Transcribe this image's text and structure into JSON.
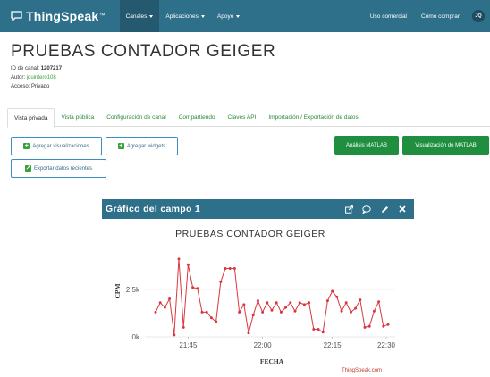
{
  "navbar": {
    "brand": "ThingSpeak",
    "brand_tm": "™",
    "menus": [
      {
        "label": "Canales",
        "active": true
      },
      {
        "label": "Aplicaciones",
        "active": false
      },
      {
        "label": "Apoyo",
        "active": false
      }
    ],
    "right_links": [
      "Uso comercial",
      "Cómo comprar"
    ],
    "avatar": "JQ"
  },
  "channel": {
    "title": "PRUEBAS CONTADOR GEIGER",
    "id_label": "ID de canal:",
    "id_value": "1207217",
    "author_label": "Autor:",
    "author_value": "jquintero108",
    "access_label": "Acceso:",
    "access_value": "Privado"
  },
  "tabs": [
    "Vista privada",
    "Vista pública",
    "Configuración de canal",
    "Compartiendo",
    "Claves API",
    "Importación / Exportación de datos"
  ],
  "buttons": {
    "add_visualizations": "Agregar visualizaciones",
    "add_widgets": "Agregar widgets",
    "export_data": "Exportar datos recientes",
    "matlab_analysis": "Análisis MATLAB",
    "matlab_visualization": "Visualización de MATLAB"
  },
  "widget": {
    "title": "Gráfico del campo 1",
    "icons": [
      "external-link-icon",
      "comment-icon",
      "pencil-icon",
      "close-icon"
    ],
    "credit": "ThingSpeak.com"
  },
  "colors": {
    "navbar": "#2e6f8a",
    "series": "#d9363e",
    "green_button": "#1f8f3f"
  },
  "chart_data": {
    "type": "line",
    "title": "PRUEBAS CONTADOR GEIGER",
    "xlabel": "FECHA",
    "ylabel": "CPM",
    "x_ticks": [
      "21:45",
      "22:00",
      "22:15",
      "22:30"
    ],
    "y_ticks": [
      "0k",
      "2.5k"
    ],
    "ylim": [
      0,
      4800
    ],
    "grid": true,
    "series": [
      {
        "values": [
          1300,
          1800,
          1550,
          2000,
          100,
          4100,
          500,
          3800,
          2600,
          2550,
          1300,
          1300,
          1000,
          800,
          2900,
          3600,
          3600,
          3600,
          1300,
          1700,
          200,
          1150,
          1900,
          1300,
          1800,
          1400,
          1800,
          1300,
          1550,
          1800,
          1350,
          1800,
          1700,
          1800,
          400,
          400,
          250,
          1900,
          2400,
          2100,
          1350,
          1800,
          1300,
          1500,
          1950,
          500,
          550,
          1350,
          1850,
          550,
          650
        ]
      }
    ]
  }
}
